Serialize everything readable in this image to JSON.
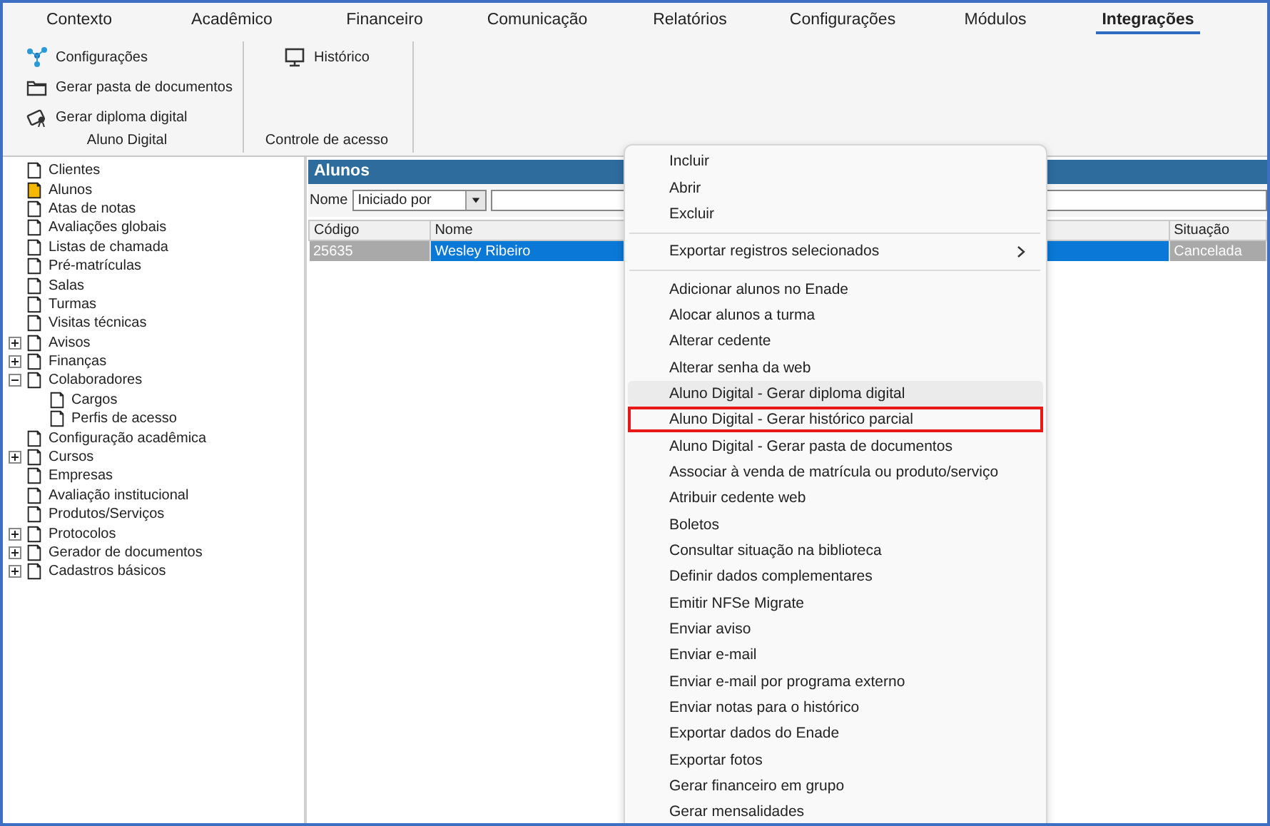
{
  "tabs": [
    {
      "label": "Contexto",
      "selected": false
    },
    {
      "label": "Acadêmico",
      "selected": false
    },
    {
      "label": "Financeiro",
      "selected": false
    },
    {
      "label": "Comunicação",
      "selected": false
    },
    {
      "label": "Relatórios",
      "selected": false
    },
    {
      "label": "Configurações",
      "selected": false
    },
    {
      "label": "Módulos",
      "selected": false
    },
    {
      "label": "Integrações",
      "selected": true
    }
  ],
  "ribbon": {
    "groups": [
      {
        "title": "Aluno Digital",
        "buttons": [
          {
            "label": "Configurações",
            "kind": "nodes"
          },
          {
            "label": "Gerar pasta de documentos",
            "kind": "folder"
          },
          {
            "label": "Gerar diploma digital",
            "kind": "diploma"
          }
        ]
      },
      {
        "title": "Controle de acesso",
        "buttons": [
          {
            "label": "Histórico",
            "kind": "monitor"
          }
        ]
      }
    ]
  },
  "tree": {
    "items": [
      {
        "label": "Clientes",
        "selected": false
      },
      {
        "label": "Alunos",
        "selected": true
      },
      {
        "label": "Atas de notas",
        "selected": false
      },
      {
        "label": "Avaliações globais",
        "selected": false
      },
      {
        "label": "Listas de chamada",
        "selected": false
      },
      {
        "label": "Pré-matrículas",
        "selected": false
      },
      {
        "label": "Salas",
        "selected": false
      },
      {
        "label": "Turmas",
        "selected": false
      },
      {
        "label": "Visitas técnicas",
        "selected": false
      },
      {
        "label": "Avisos",
        "selected": false,
        "expanded": false
      },
      {
        "label": "Finanças",
        "selected": false,
        "expanded": false
      },
      {
        "label": "Colaboradores",
        "selected": false,
        "expanded": true,
        "children": [
          {
            "label": "Cargos",
            "selected": false
          },
          {
            "label": "Perfis de acesso",
            "selected": false
          }
        ]
      },
      {
        "label": "Configuração acadêmica",
        "selected": false
      },
      {
        "label": "Cursos",
        "selected": false,
        "expanded": false
      },
      {
        "label": "Empresas",
        "selected": false
      },
      {
        "label": "Avaliação institucional",
        "selected": false
      },
      {
        "label": "Produtos/Serviços",
        "selected": false
      },
      {
        "label": "Protocolos",
        "selected": false,
        "expanded": false
      },
      {
        "label": "Gerador de documentos",
        "selected": false,
        "expanded": false
      },
      {
        "label": "Cadastros básicos",
        "selected": false,
        "expanded": false
      }
    ]
  },
  "grid": {
    "title": "Alunos",
    "filter": {
      "label": "Nome",
      "operator": "Iniciado por"
    },
    "columns": [
      "Código",
      "Nome",
      "Situação"
    ],
    "rows": [
      {
        "selected": true,
        "cells": [
          {
            "text": "25635",
            "focused": false
          },
          {
            "text": "Wesley Ribeiro",
            "focused": true
          },
          {
            "text": "Cancelada",
            "focused": false
          }
        ]
      }
    ]
  },
  "context_menu": {
    "items": [
      {
        "kind": "item",
        "label": "Incluir",
        "hovered": false,
        "highlighted": false
      },
      {
        "kind": "item",
        "label": "Abrir",
        "hovered": false,
        "highlighted": false
      },
      {
        "kind": "item",
        "label": "Excluir",
        "hovered": false,
        "highlighted": false
      },
      {
        "kind": "separator"
      },
      {
        "kind": "submenu",
        "label": "Exportar registros selecionados",
        "hovered": false,
        "highlighted": false
      },
      {
        "kind": "separator"
      },
      {
        "kind": "item",
        "label": "Adicionar alunos no Enade",
        "hovered": false,
        "highlighted": false
      },
      {
        "kind": "item",
        "label": "Alocar alunos a turma",
        "hovered": false,
        "highlighted": false
      },
      {
        "kind": "item",
        "label": "Alterar cedente",
        "hovered": false,
        "highlighted": false
      },
      {
        "kind": "item",
        "label": "Alterar senha da web",
        "hovered": false,
        "highlighted": false
      },
      {
        "kind": "item",
        "label": "Aluno Digital - Gerar diploma digital",
        "hovered": true,
        "highlighted": false
      },
      {
        "kind": "item",
        "label": "Aluno Digital - Gerar histórico parcial",
        "hovered": false,
        "highlighted": true
      },
      {
        "kind": "item",
        "label": "Aluno Digital - Gerar pasta de documentos",
        "hovered": false,
        "highlighted": false
      },
      {
        "kind": "item",
        "label": "Associar à venda de matrícula ou produto/serviço",
        "hovered": false,
        "highlighted": false
      },
      {
        "kind": "item",
        "label": "Atribuir cedente web",
        "hovered": false,
        "highlighted": false
      },
      {
        "kind": "item",
        "label": "Boletos",
        "hovered": false,
        "highlighted": false
      },
      {
        "kind": "item",
        "label": "Consultar situação na biblioteca",
        "hovered": false,
        "highlighted": false
      },
      {
        "kind": "item",
        "label": "Definir dados complementares",
        "hovered": false,
        "highlighted": false
      },
      {
        "kind": "item",
        "label": "Emitir NFSe Migrate",
        "hovered": false,
        "highlighted": false
      },
      {
        "kind": "item",
        "label": "Enviar aviso",
        "hovered": false,
        "highlighted": false
      },
      {
        "kind": "item",
        "label": "Enviar e-mail",
        "hovered": false,
        "highlighted": false
      },
      {
        "kind": "item",
        "label": "Enviar e-mail por programa externo",
        "hovered": false,
        "highlighted": false
      },
      {
        "kind": "item",
        "label": "Enviar notas para o histórico",
        "hovered": false,
        "highlighted": false
      },
      {
        "kind": "item",
        "label": "Exportar dados do Enade",
        "hovered": false,
        "highlighted": false
      },
      {
        "kind": "item",
        "label": "Exportar fotos",
        "hovered": false,
        "highlighted": false
      },
      {
        "kind": "item",
        "label": "Gerar financeiro em grupo",
        "hovered": false,
        "highlighted": false
      },
      {
        "kind": "item",
        "label": "Gerar mensalidades",
        "hovered": false,
        "highlighted": false
      }
    ]
  }
}
